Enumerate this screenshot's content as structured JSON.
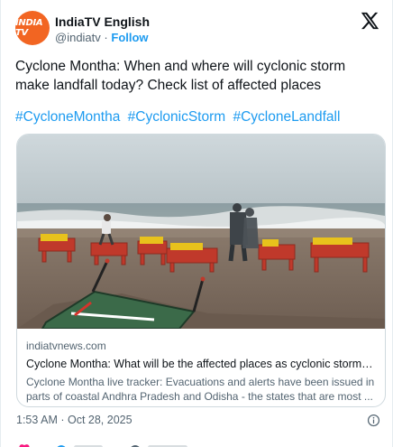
{
  "account": {
    "name": "IndiaTV English",
    "handle": "@indiatv",
    "separator": "·",
    "follow_label": "Follow",
    "avatar_text": "INDIA TV",
    "avatar_color": "#f26522"
  },
  "tweet": {
    "text": "Cyclone Montha: When and where will cyclonic storm make landfall today? Check list of affected places",
    "hashtags": [
      "#CycloneMontha",
      "#CyclonicStorm",
      "#CycloneLandfall"
    ]
  },
  "link_card": {
    "domain": "indiatvnews.com",
    "title": "Cyclone Montha: What will be the affected places as cyclonic storm mak...",
    "description": "Cyclone Montha live tracker: Evacuations and alerts have been issued in parts of coastal Andhra Pradesh and Odisha - the states that are most ..."
  },
  "timestamp": "1:53 AM · Oct 28, 2025",
  "colors": {
    "accent": "#1d9bf0",
    "text": "#0f1419",
    "muted": "#536471",
    "border": "#cfd9de"
  },
  "icons": [
    "x-logo-icon",
    "info-icon",
    "heart-icon",
    "reply-icon",
    "link-icon"
  ]
}
